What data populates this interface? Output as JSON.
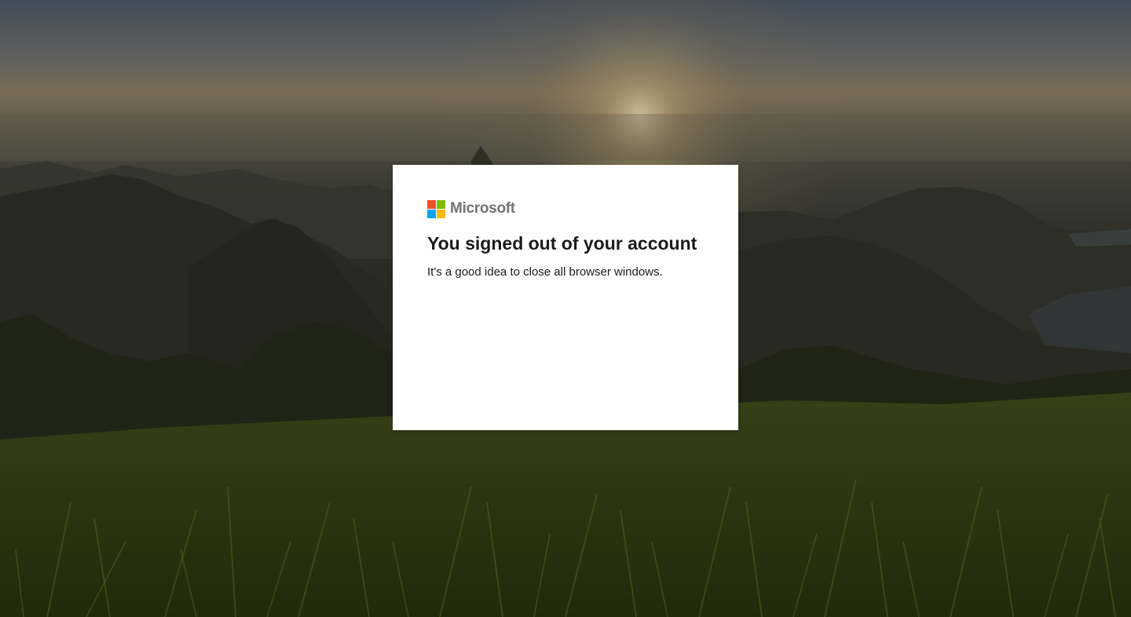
{
  "brand": {
    "name": "Microsoft",
    "logo_colors": {
      "red": "#f25022",
      "green": "#7fba00",
      "blue": "#00a4ef",
      "yellow": "#ffb900"
    }
  },
  "signout": {
    "title": "You signed out of your account",
    "message": "It's a good idea to close all browser windows."
  },
  "background": {
    "image": "landscape-photo-sunrise-over-mountains-and-grass"
  }
}
